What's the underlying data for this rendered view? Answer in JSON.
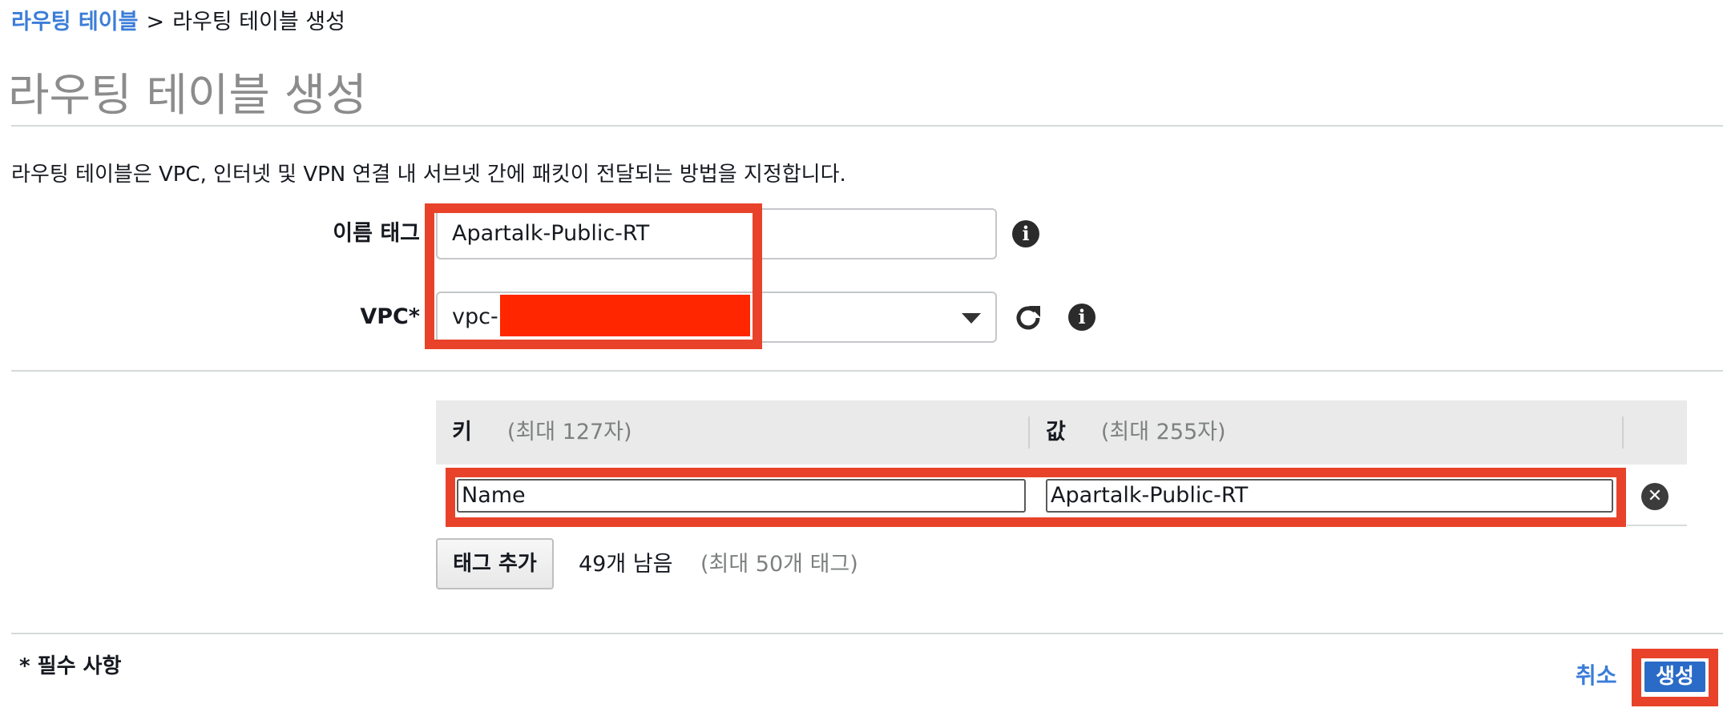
{
  "breadcrumb": {
    "parent": "라우팅 테이블",
    "separator": ">",
    "current": "라우팅 테이블 생성"
  },
  "title": "라우팅 테이블 생성",
  "description": "라우팅 테이블은 VPC, 인터넷 및 VPN 연결 내 서브넷 간에 패킷이 전달되는 방법을 지정합니다.",
  "form": {
    "name_tag_label": "이름 태그",
    "name_tag_value": "Apartalk-Public-RT",
    "vpc_label": "VPC*",
    "vpc_value_prefix": "vpc-"
  },
  "tags": {
    "key_header": "키",
    "key_hint": "(최대 127자)",
    "value_header": "값",
    "value_hint": "(최대 255자)",
    "rows": [
      {
        "key": "Name",
        "value": "Apartalk-Public-RT"
      }
    ],
    "add_label": "태그 추가",
    "remaining": "49개 남음",
    "max_note": "(최대 50개 태그)"
  },
  "footer": {
    "required_note": "* 필수 사항",
    "cancel_label": "취소",
    "create_label": "생성"
  },
  "icons": {
    "info": "info-icon",
    "refresh": "refresh-icon",
    "dropdown": "chevron-down-icon",
    "remove": "remove-circle-icon"
  },
  "colors": {
    "link": "#3b7dd8",
    "primary_button": "#2a6bc7",
    "highlight": "#e8432a",
    "redaction": "#ff2600"
  }
}
